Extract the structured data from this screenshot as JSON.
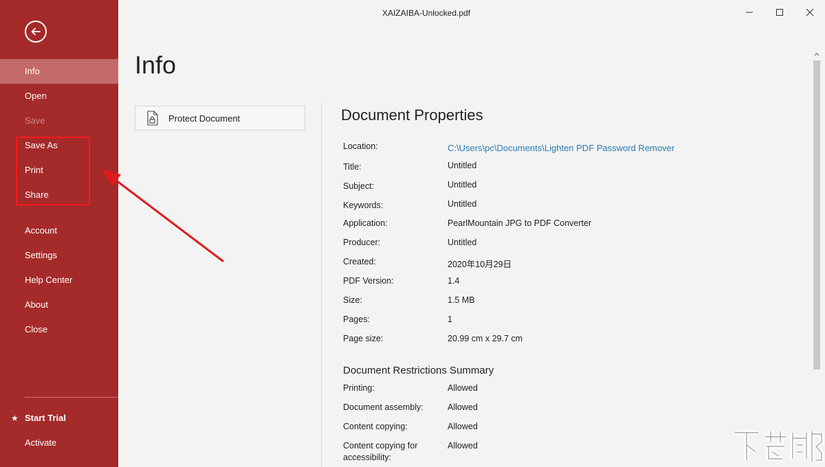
{
  "window": {
    "title": "XAIZAIBA-Unlocked.pdf",
    "controls": [
      "minimize",
      "maximize",
      "close"
    ]
  },
  "sidebar": {
    "background": "#a52a2a",
    "items": [
      {
        "label": "Info",
        "active": true
      },
      {
        "label": "Open"
      },
      {
        "label": "Save",
        "disabled": true
      },
      {
        "label": "Save As"
      },
      {
        "label": "Print"
      },
      {
        "label": "Share"
      },
      {
        "label": "Account"
      },
      {
        "label": "Settings"
      },
      {
        "label": "Help Center"
      },
      {
        "label": "About"
      },
      {
        "label": "Close"
      }
    ],
    "trial_label": "Start Trial",
    "activate_label": "Activate"
  },
  "main": {
    "page_title": "Info",
    "protect_button": "Protect Document",
    "properties_heading": "Document Properties",
    "properties": [
      {
        "label": "Location:",
        "value": "C:\\Users\\pc\\Documents\\Lighten PDF Password Remover",
        "is_link": true
      },
      {
        "label": "Title:",
        "value": "Untitled"
      },
      {
        "label": "Subject:",
        "value": "Untitled"
      },
      {
        "label": "Keywords:",
        "value": "Untitled"
      },
      {
        "label": "Application:",
        "value": "PearlMountain JPG to PDF Converter"
      },
      {
        "label": "Producer:",
        "value": "Untitled"
      },
      {
        "label": "Created:",
        "value": "2020年10月29日"
      },
      {
        "label": "PDF Version:",
        "value": "1.4"
      },
      {
        "label": "Size:",
        "value": "1.5 MB"
      },
      {
        "label": "Pages:",
        "value": "1"
      },
      {
        "label": "Page size:",
        "value": "20.99 cm x 29.7 cm"
      }
    ],
    "restrictions_heading": "Document Restrictions Summary",
    "restrictions": [
      {
        "label": "Printing:",
        "value": "Allowed"
      },
      {
        "label": "Document assembly:",
        "value": "Allowed"
      },
      {
        "label": "Content copying:",
        "value": "Allowed"
      },
      {
        "label": "Content copying for",
        "label2": "accessibility:",
        "value": "Allowed"
      }
    ]
  },
  "annotation": {
    "highlight_color": "#ff1a1a"
  },
  "watermark_icon": "xiazaiba-logo"
}
